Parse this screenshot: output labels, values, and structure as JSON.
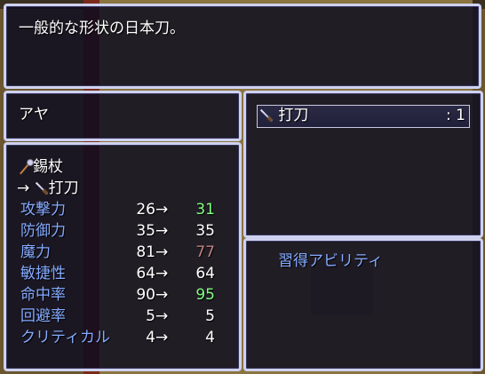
{
  "help": {
    "description": "一般的な形状の日本刀。"
  },
  "actor": {
    "name": "アヤ"
  },
  "equip": {
    "current_item": "錫杖",
    "current_icon": "staff-icon",
    "arrow": "→",
    "new_item": "打刀",
    "new_icon": "sword-icon"
  },
  "stats": [
    {
      "label": "攻撃力",
      "old": "26",
      "arrow": "→",
      "new": "31",
      "change": "up"
    },
    {
      "label": "防御力",
      "old": "35",
      "arrow": "→",
      "new": "35",
      "change": "same"
    },
    {
      "label": "魔力",
      "old": "81",
      "arrow": "→",
      "new": "77",
      "change": "down"
    },
    {
      "label": "敏捷性",
      "old": "64",
      "arrow": "→",
      "new": "64",
      "change": "same"
    },
    {
      "label": "命中率",
      "old": "90",
      "arrow": "→",
      "new": "95",
      "change": "up"
    },
    {
      "label": "回避率",
      "old": "5",
      "arrow": "→",
      "new": "5",
      "change": "same"
    },
    {
      "label": "クリティカル",
      "old": "4",
      "arrow": "→",
      "new": "4",
      "change": "same"
    }
  ],
  "item_list": [
    {
      "name": "打刀",
      "icon": "sword-icon",
      "separator": ":",
      "count": "1"
    }
  ],
  "ability": {
    "header": "習得アビリティ"
  },
  "colors": {
    "system": "#84aaff",
    "up": "#80ff80",
    "down": "#c08080",
    "window_border": "#cfd2ee"
  }
}
